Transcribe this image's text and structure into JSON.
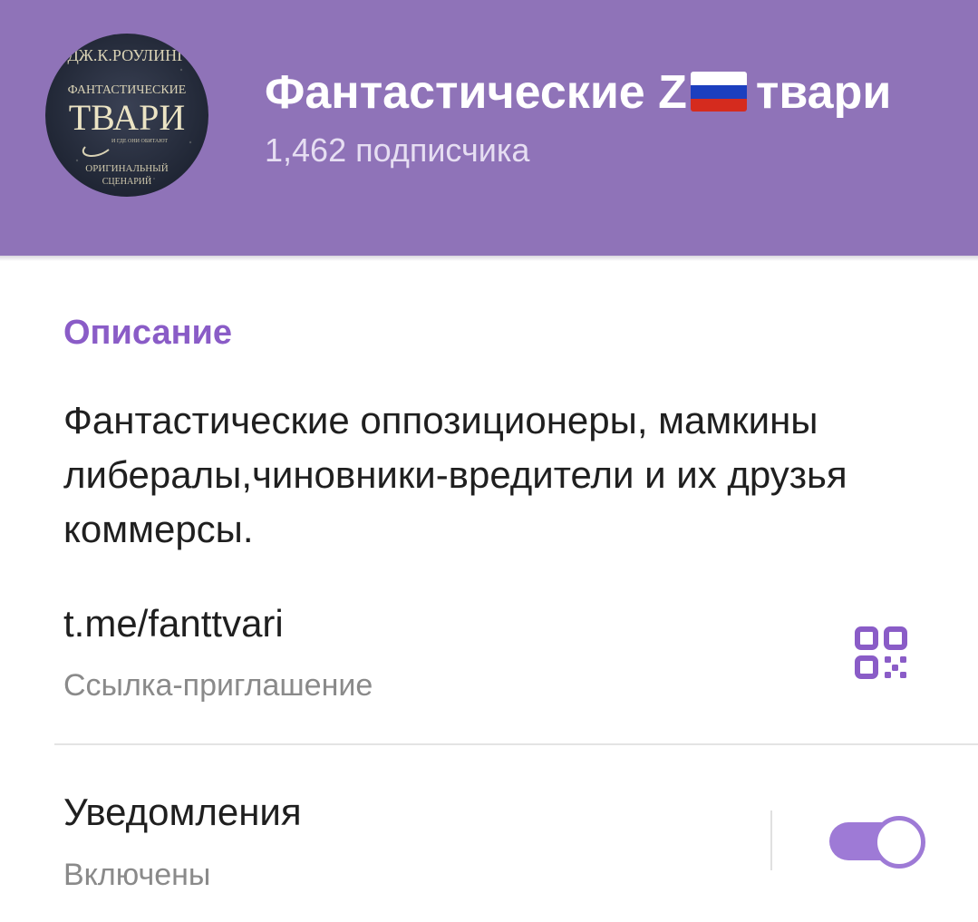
{
  "channel": {
    "title_part1": "Фантастические Z",
    "title_part2": "твари",
    "subscribers": "1,462 подписчика",
    "avatar": {
      "line_top": "ДЖ.К.РОУЛИНГ",
      "line_small": "ФАНТАСТИЧЕСКИЕ",
      "line_big": "ТВАРИ",
      "line_sub": "И ГДЕ ОНИ ОБИТАЮТ",
      "line_bottom1": "ОРИГИНАЛЬНЫЙ",
      "line_bottom2": "СЦЕНАРИЙ"
    },
    "flag_colors": [
      "#ffffff",
      "#1c3fbf",
      "#d52b1e"
    ]
  },
  "info": {
    "section_title": "Описание",
    "description": "Фантастические оппозиционеры, мамкины либералы,чиновники-вредители и их друзья коммерсы.",
    "link": "t.me/fanttvari",
    "link_caption": "Ссылка-приглашение",
    "qr_icon": "qr-code-icon"
  },
  "notifications": {
    "title": "Уведомления",
    "status": "Включены",
    "enabled": true
  },
  "colors": {
    "header": "#8f73b8",
    "accent": "#8a5cc7",
    "toggle": "#9e7ad6"
  }
}
